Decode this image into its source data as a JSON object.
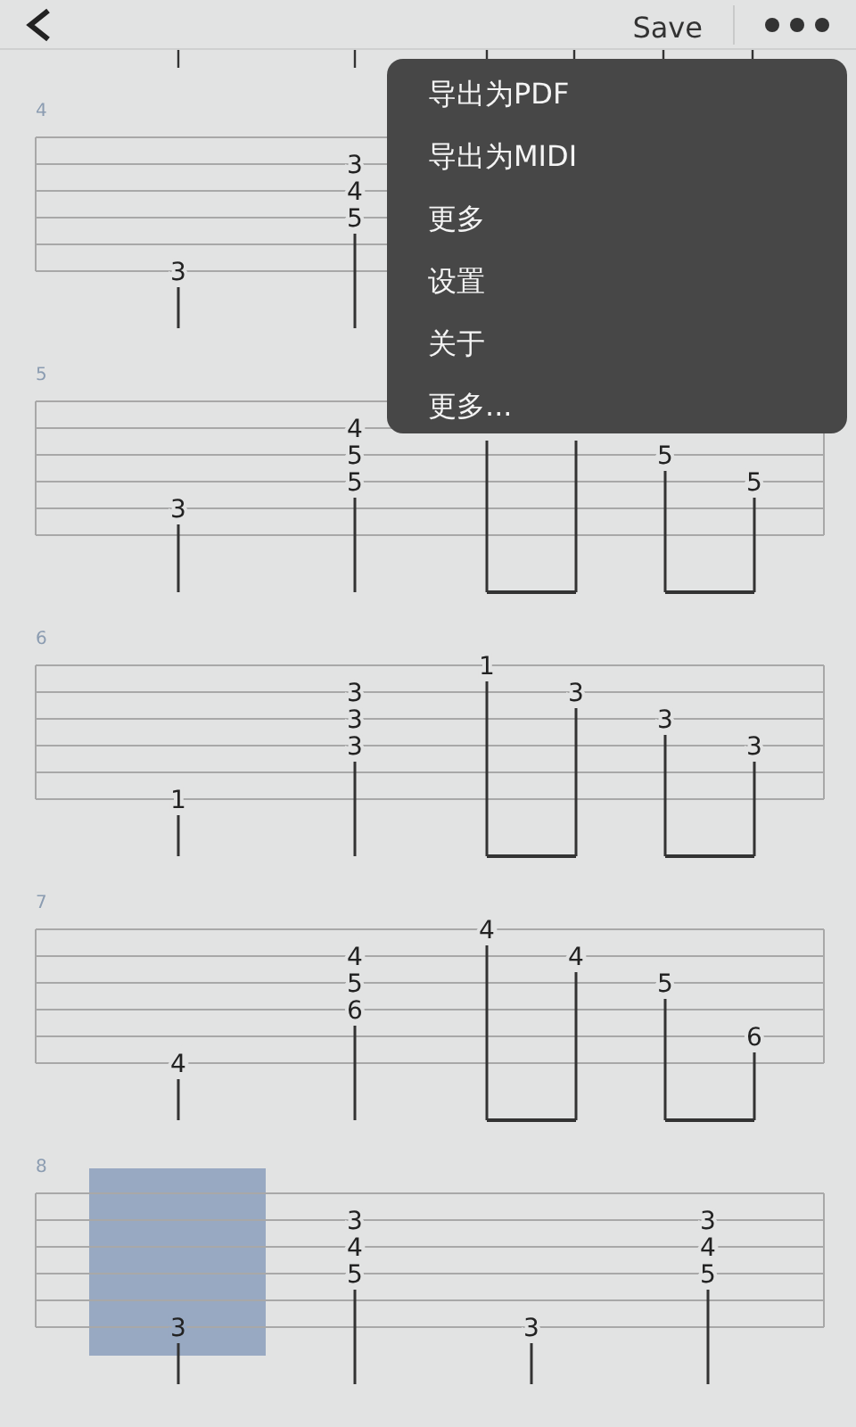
{
  "toolbar": {
    "save": "Save"
  },
  "measures": [
    {
      "number": "4",
      "slots": [
        {
          "kind": "quarter",
          "selected": false,
          "frets": {
            "string_6": "3"
          }
        },
        {
          "kind": "quarter",
          "selected": false,
          "frets": {
            "string_2": "3",
            "string_3": "4",
            "string_4": "5"
          }
        }
      ]
    },
    {
      "number": "5",
      "slots": [
        {
          "kind": "quarter",
          "selected": false,
          "frets": {
            "string_5": "3"
          }
        },
        {
          "kind": "quarter",
          "selected": false,
          "frets": {
            "string_2": "4",
            "string_3": "5",
            "string_4": "5"
          }
        },
        {
          "kind": "eighth",
          "selected": false
        },
        {
          "kind": "eighth",
          "selected": false
        },
        {
          "kind": "eighth",
          "selected": false,
          "frets": {
            "string_3": "5"
          }
        },
        {
          "kind": "eighth",
          "selected": false,
          "frets": {
            "string_4": "5"
          }
        }
      ]
    },
    {
      "number": "6",
      "slots": [
        {
          "kind": "quarter",
          "selected": false,
          "frets": {
            "string_6": "1"
          }
        },
        {
          "kind": "quarter",
          "selected": false,
          "frets": {
            "string_2": "3",
            "string_3": "3",
            "string_4": "3"
          }
        },
        {
          "kind": "eighth",
          "selected": false,
          "frets": {
            "string_1": "1"
          }
        },
        {
          "kind": "eighth",
          "selected": false,
          "frets": {
            "string_2": "3"
          }
        },
        {
          "kind": "eighth",
          "selected": false,
          "frets": {
            "string_3": "3"
          }
        },
        {
          "kind": "eighth",
          "selected": false,
          "frets": {
            "string_4": "3"
          }
        }
      ]
    },
    {
      "number": "7",
      "slots": [
        {
          "kind": "quarter",
          "selected": false,
          "frets": {
            "string_6": "4"
          }
        },
        {
          "kind": "quarter",
          "selected": false,
          "frets": {
            "string_2": "4",
            "string_3": "5",
            "string_4": "6"
          }
        },
        {
          "kind": "eighth",
          "selected": false,
          "frets": {
            "string_1": "4"
          }
        },
        {
          "kind": "eighth",
          "selected": false,
          "frets": {
            "string_2": "4"
          }
        },
        {
          "kind": "eighth",
          "selected": false,
          "frets": {
            "string_3": "5"
          }
        },
        {
          "kind": "eighth",
          "selected": false,
          "frets": {
            "string_5": "6"
          }
        }
      ]
    },
    {
      "number": "8",
      "slots": [
        {
          "kind": "quarter",
          "selected": true,
          "frets": {
            "string_6": "3"
          }
        },
        {
          "kind": "quarter",
          "selected": false,
          "frets": {
            "string_2": "3",
            "string_3": "4",
            "string_4": "5"
          }
        },
        {
          "kind": "quarter",
          "selected": false,
          "frets": {
            "string_6": "3"
          }
        },
        {
          "kind": "quarter",
          "selected": false,
          "frets": {
            "string_2": "3",
            "string_3": "4",
            "string_4": "5"
          }
        }
      ]
    }
  ],
  "menu": {
    "items": [
      "导出为PDF",
      "导出为MIDI",
      "更多",
      "设置",
      "关于",
      "更多..."
    ]
  }
}
